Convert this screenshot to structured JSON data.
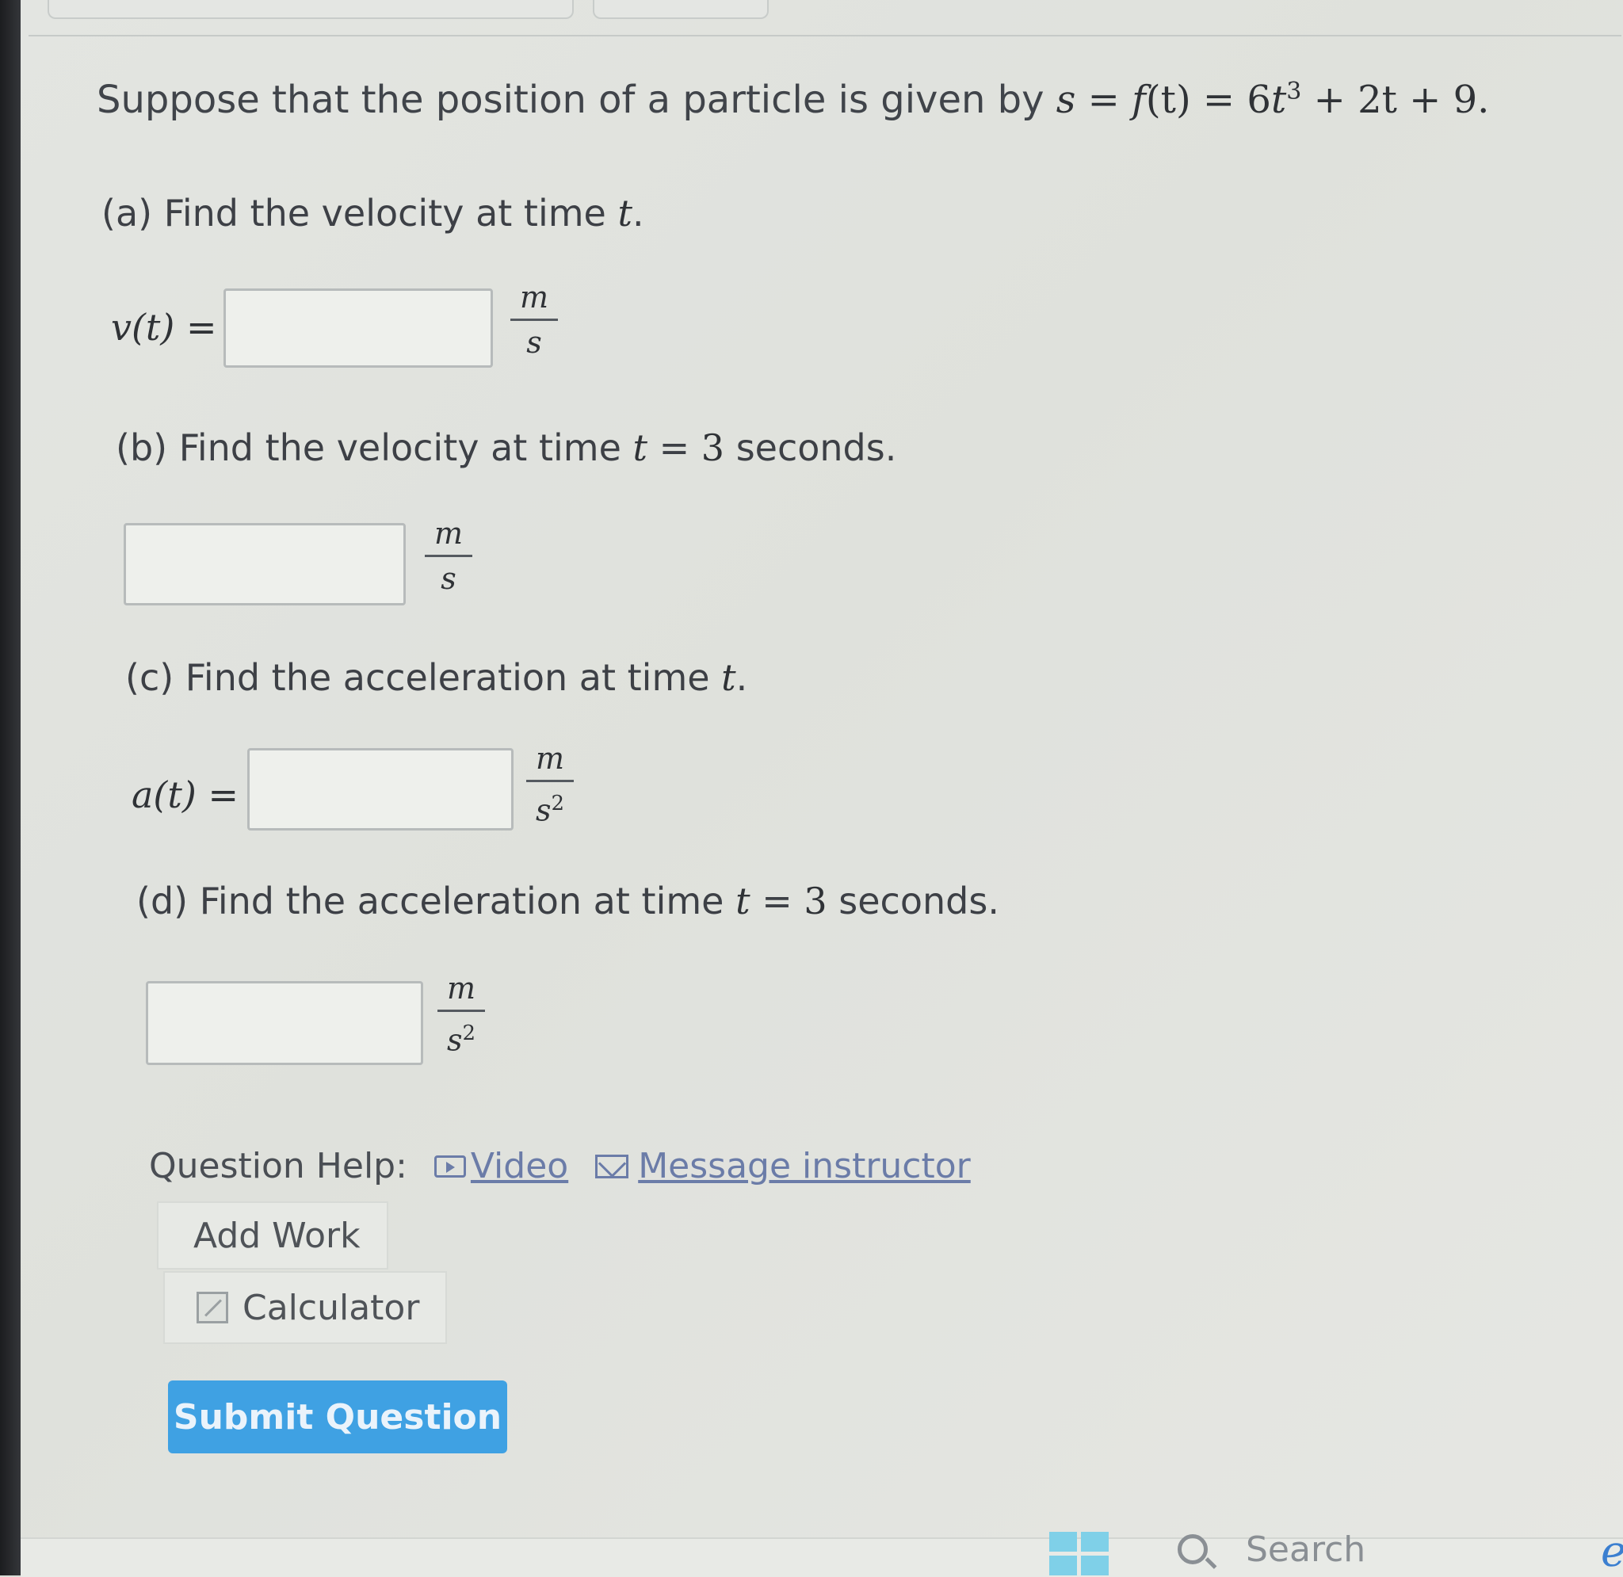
{
  "problem": {
    "statement_text": "Suppose that the position of a particle is given by ",
    "function": {
      "lhs": "s",
      "eq1": " = ",
      "f": "f",
      "arg": "(t)",
      "eq2": " = 6",
      "t": "t",
      "exp": "3",
      "rest": " + 2t + 9."
    }
  },
  "parts": {
    "a": {
      "prompt": "(a) Find the velocity at time ",
      "var": "t",
      "end": ".",
      "label": "v(t)",
      "eq": "=",
      "unit_num": "m",
      "unit_den": "s",
      "value": ""
    },
    "b": {
      "prompt": "(b) Find the velocity at time ",
      "var": "t",
      "eqsign": " = ",
      "num": "3",
      "end": " seconds.",
      "unit_num": "m",
      "unit_den": "s",
      "value": ""
    },
    "c": {
      "prompt": "(c) Find the acceleration at time ",
      "var": "t",
      "end": ".",
      "label": "a(t)",
      "eq": "=",
      "unit_num": "m",
      "unit_den": "s",
      "unit_den_exp": "2",
      "value": ""
    },
    "d": {
      "prompt": "(d) Find the acceleration at time ",
      "var": "t",
      "eqsign": " = ",
      "num": "3",
      "end": " seconds.",
      "unit_num": "m",
      "unit_den": "s",
      "unit_den_exp": "2",
      "value": ""
    }
  },
  "help": {
    "label": "Question Help:",
    "video": "Video",
    "message": "Message instructor",
    "video_icon": "video-icon",
    "message_icon": "mail-icon"
  },
  "add_work": "Add Work",
  "calculator": "Calculator",
  "submit": "Submit Question",
  "taskbar": {
    "search": "Search",
    "windows_icon": "windows-icon",
    "search_icon": "search-icon"
  },
  "colors": {
    "accent": "#3fa1e3",
    "link": "#6b7ca8"
  }
}
